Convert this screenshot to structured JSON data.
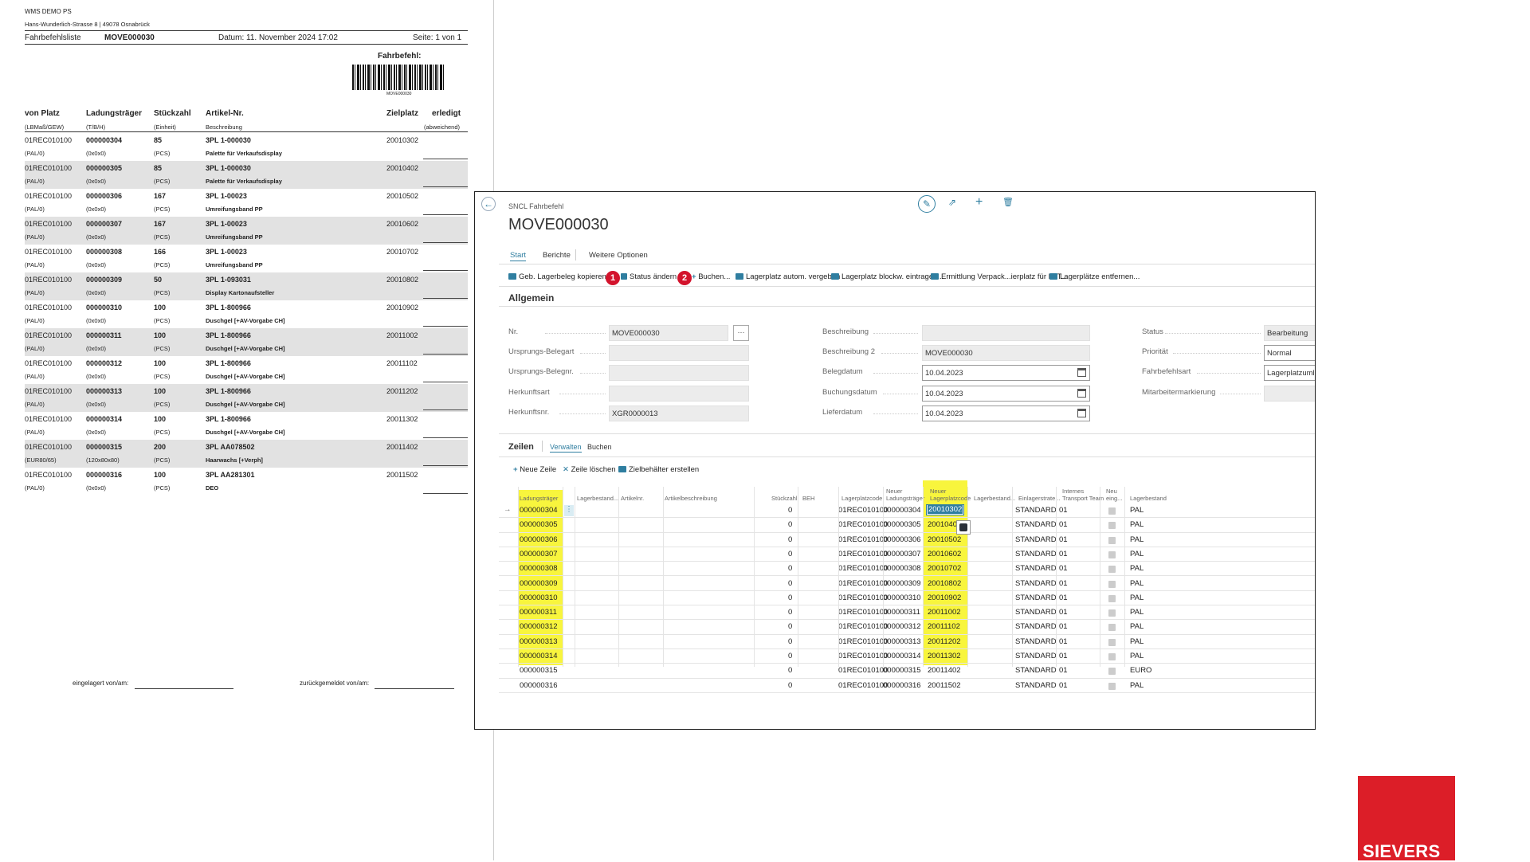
{
  "report": {
    "company": "WMS DEMO PS",
    "address": "Hans-Wunderlich-Strasse 8 | 49078 Osnabrück",
    "list_label": "Fahrbefehlsliste",
    "move_no": "MOVE000030",
    "date": "Datum: 11. November 2024 17:02",
    "page": "Seite: 1 von 1",
    "fahrbefehl_label": "Fahrbefehl:",
    "barcode_text": "MOVE000030",
    "headers": {
      "von_platz": "von Platz",
      "von_platz_sub": "(LBMaß/GEW)",
      "ladungstraeger": "Ladungsträger",
      "ladungstraeger_sub": "(T/B/H)",
      "stueckzahl": "Stückzahl",
      "stueckzahl_sub": "(Einheit)",
      "artikel": "Artikel-Nr.",
      "artikel_sub": "Beschreibung",
      "zielplatz": "Zielplatz",
      "erledigt": "erledigt",
      "erledigt_sub": "(abweichend)"
    },
    "rows": [
      {
        "von": "01REC010100",
        "pal": "(PAL/0)",
        "lt": "000000304",
        "dim": "(0x0x0)",
        "qty": "85",
        "unit": "(PCS)",
        "art": "3PL 1-000030",
        "desc": "Palette für Verkaufsdisplay",
        "ziel": "20010302"
      },
      {
        "von": "01REC010100",
        "pal": "(PAL/0)",
        "lt": "000000305",
        "dim": "(0x0x0)",
        "qty": "85",
        "unit": "(PCS)",
        "art": "3PL 1-000030",
        "desc": "Palette für Verkaufsdisplay",
        "ziel": "20010402"
      },
      {
        "von": "01REC010100",
        "pal": "(PAL/0)",
        "lt": "000000306",
        "dim": "(0x0x0)",
        "qty": "167",
        "unit": "(PCS)",
        "art": "3PL 1-00023",
        "desc": "Umreifungsband PP",
        "ziel": "20010502"
      },
      {
        "von": "01REC010100",
        "pal": "(PAL/0)",
        "lt": "000000307",
        "dim": "(0x0x0)",
        "qty": "167",
        "unit": "(PCS)",
        "art": "3PL 1-00023",
        "desc": "Umreifungsband PP",
        "ziel": "20010602"
      },
      {
        "von": "01REC010100",
        "pal": "(PAL/0)",
        "lt": "000000308",
        "dim": "(0x0x0)",
        "qty": "166",
        "unit": "(PCS)",
        "art": "3PL 1-00023",
        "desc": "Umreifungsband PP",
        "ziel": "20010702"
      },
      {
        "von": "01REC010100",
        "pal": "(PAL/0)",
        "lt": "000000309",
        "dim": "(0x0x0)",
        "qty": "50",
        "unit": "(PCS)",
        "art": "3PL 1-093031",
        "desc": "Display Kartonaufsteller",
        "ziel": "20010802"
      },
      {
        "von": "01REC010100",
        "pal": "(PAL/0)",
        "lt": "000000310",
        "dim": "(0x0x0)",
        "qty": "100",
        "unit": "(PCS)",
        "art": "3PL 1-800966",
        "desc": "Duschgel [+AV-Vorgabe CH]",
        "ziel": "20010902"
      },
      {
        "von": "01REC010100",
        "pal": "(PAL/0)",
        "lt": "000000311",
        "dim": "(0x0x0)",
        "qty": "100",
        "unit": "(PCS)",
        "art": "3PL 1-800966",
        "desc": "Duschgel [+AV-Vorgabe CH]",
        "ziel": "20011002"
      },
      {
        "von": "01REC010100",
        "pal": "(PAL/0)",
        "lt": "000000312",
        "dim": "(0x0x0)",
        "qty": "100",
        "unit": "(PCS)",
        "art": "3PL 1-800966",
        "desc": "Duschgel [+AV-Vorgabe CH]",
        "ziel": "20011102"
      },
      {
        "von": "01REC010100",
        "pal": "(PAL/0)",
        "lt": "000000313",
        "dim": "(0x0x0)",
        "qty": "100",
        "unit": "(PCS)",
        "art": "3PL 1-800966",
        "desc": "Duschgel [+AV-Vorgabe CH]",
        "ziel": "20011202"
      },
      {
        "von": "01REC010100",
        "pal": "(PAL/0)",
        "lt": "000000314",
        "dim": "(0x0x0)",
        "qty": "100",
        "unit": "(PCS)",
        "art": "3PL 1-800966",
        "desc": "Duschgel [+AV-Vorgabe CH]",
        "ziel": "20011302"
      },
      {
        "von": "01REC010100",
        "pal": "(EUR80/65)",
        "lt": "000000315",
        "dim": "(120x80x80)",
        "qty": "200",
        "unit": "(PCS)",
        "art": "3PL AA078502",
        "desc": "Haarwachs [+Verph]",
        "ziel": "20011402"
      },
      {
        "von": "01REC010100",
        "pal": "(PAL/0)",
        "lt": "000000316",
        "dim": "(0x0x0)",
        "qty": "100",
        "unit": "(PCS)",
        "art": "3PL AA281301",
        "desc": "DEO",
        "ziel": "20011502"
      }
    ],
    "footer_left": "eingelagert von/am:",
    "footer_right": "zurückgemeldet von/am:"
  },
  "bc": {
    "breadcrumb": "SNCL Fahrbefehl",
    "title": "MOVE000030",
    "tabs": [
      "Start",
      "Berichte",
      "Weitere Optionen"
    ],
    "actions": {
      "a1": "Geb. Lagerbeleg kopieren",
      "a2": "Status ändern",
      "a3": "Buchen...",
      "a4": "Lagerplatz autom. vergeben",
      "a5": "Lagerplatz blockw. eintragen...",
      "a6": "Ermittlung Verpack...ierplatz für KLT...",
      "a7": "Lagerplätze entfernen..."
    },
    "badge1": "1",
    "badge2": "2",
    "section": "Allgemein",
    "fields": {
      "nr_label": "Nr.",
      "nr_value": "MOVE000030",
      "ursprungs_belegart_label": "Ursprungs-Belegart",
      "ursprungs_belegnr_label": "Ursprungs-Belegnr.",
      "herkunftsart_label": "Herkunftsart",
      "herkunftsnr_label": "Herkunftsnr.",
      "herkunftsnr_value": "XGR0000013",
      "beschreibung_label": "Beschreibung",
      "beschreibung2_label": "Beschreibung 2",
      "beschreibung2_value": "MOVE000030",
      "belegdatum_label": "Belegdatum",
      "belegdatum_value": "10.04.2023",
      "buchungsdatum_label": "Buchungsdatum",
      "buchungsdatum_value": "10.04.2023",
      "lieferdatum_label": "Lieferdatum",
      "lieferdatum_value": "10.04.2023",
      "status_label": "Status",
      "status_value": "Bearbeitung",
      "prioritaet_label": "Priorität",
      "prioritaet_value": "Normal",
      "fahrbefehlsart_label": "Fahrbefehlsart",
      "fahrbefehlsart_value": "Lagerplatzuml",
      "mitarbeiter_label": "Mitarbeitermarkierung",
      "nr_more": "···"
    },
    "lines": {
      "title": "Zeilen",
      "tab_verwalten": "Verwalten",
      "tab_buchen": "Buchen",
      "new_line": "Neue Zeile",
      "delete_line": "Zeile löschen",
      "zielbehaelter": "Zielbehälter erstellen"
    },
    "columns": {
      "ladungstraeger": "Ladungsträger",
      "lagerbestand": "Lagerbestand...",
      "artikelnr": "Artikelnr.",
      "artikelbeschreibung": "Artikelbeschreibung",
      "stueckzahl": "Stückzahl",
      "beh": "BEH",
      "lagerplatzcode": "Lagerplatzcode",
      "neuer_lt_1": "Neuer",
      "neuer_lt_2": "Ladungsträger",
      "neuer_lp_1": "Neuer",
      "neuer_lp_2": "Lagerplatzcode",
      "lagerbestand2": "Lagerbestand...",
      "einlagerstrat": "Einlagerstrate...",
      "intern_1": "Internes",
      "intern_2": "Transport Team",
      "neu_1": "Neu",
      "neu_2": "eing...",
      "lagerbestand3": "Lagerbestand"
    },
    "rows": [
      {
        "lt": "000000304",
        "qty": "0",
        "lp": "01REC010100",
        "nlt": "000000304",
        "nlp": "20010302",
        "strat": "STANDARD",
        "team": "01",
        "lb": "PAL"
      },
      {
        "lt": "000000305",
        "qty": "0",
        "lp": "01REC010100",
        "nlt": "000000305",
        "nlp": "20010402",
        "strat": "STANDARD",
        "team": "01",
        "lb": "PAL"
      },
      {
        "lt": "000000306",
        "qty": "0",
        "lp": "01REC010100",
        "nlt": "000000306",
        "nlp": "20010502",
        "strat": "STANDARD",
        "team": "01",
        "lb": "PAL"
      },
      {
        "lt": "000000307",
        "qty": "0",
        "lp": "01REC010100",
        "nlt": "000000307",
        "nlp": "20010602",
        "strat": "STANDARD",
        "team": "01",
        "lb": "PAL"
      },
      {
        "lt": "000000308",
        "qty": "0",
        "lp": "01REC010100",
        "nlt": "000000308",
        "nlp": "20010702",
        "strat": "STANDARD",
        "team": "01",
        "lb": "PAL"
      },
      {
        "lt": "000000309",
        "qty": "0",
        "lp": "01REC010100",
        "nlt": "000000309",
        "nlp": "20010802",
        "strat": "STANDARD",
        "team": "01",
        "lb": "PAL"
      },
      {
        "lt": "000000310",
        "qty": "0",
        "lp": "01REC010100",
        "nlt": "000000310",
        "nlp": "20010902",
        "strat": "STANDARD",
        "team": "01",
        "lb": "PAL"
      },
      {
        "lt": "000000311",
        "qty": "0",
        "lp": "01REC010100",
        "nlt": "000000311",
        "nlp": "20011002",
        "strat": "STANDARD",
        "team": "01",
        "lb": "PAL"
      },
      {
        "lt": "000000312",
        "qty": "0",
        "lp": "01REC010100",
        "nlt": "000000312",
        "nlp": "20011102",
        "strat": "STANDARD",
        "team": "01",
        "lb": "PAL"
      },
      {
        "lt": "000000313",
        "qty": "0",
        "lp": "01REC010100",
        "nlt": "000000313",
        "nlp": "20011202",
        "strat": "STANDARD",
        "team": "01",
        "lb": "PAL"
      },
      {
        "lt": "000000314",
        "qty": "0",
        "lp": "01REC010100",
        "nlt": "000000314",
        "nlp": "20011302",
        "strat": "STANDARD",
        "team": "01",
        "lb": "PAL"
      },
      {
        "lt": "000000315",
        "qty": "0",
        "lp": "01REC010100",
        "nlt": "000000315",
        "nlp": "20011402",
        "strat": "STANDARD",
        "team": "01",
        "lb": "EURO"
      },
      {
        "lt": "000000316",
        "qty": "0",
        "lp": "01REC010100",
        "nlt": "000000316",
        "nlp": "20011502",
        "strat": "STANDARD",
        "team": "01",
        "lb": "PAL"
      }
    ]
  },
  "brand": {
    "name": "SIEVERS",
    "color": "#dc1e28"
  },
  "colors": {
    "highlight": "#f8f53d",
    "badge": "#d3132c",
    "accent": "#2f7ea0"
  }
}
